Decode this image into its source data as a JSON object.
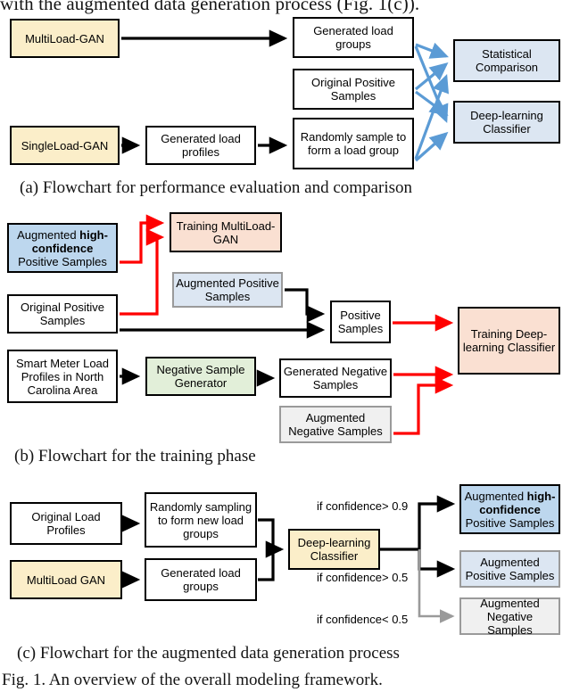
{
  "document": {
    "top_cutoff_line": "with the augmented data generation process (Fig. 1(c)).",
    "figure_caption": "Fig. 1.   An overview of the overall modeling framework."
  },
  "colors": {
    "cream": "#fbeec9",
    "blue_medium": "#bdd7ee",
    "blue_light": "#dce6f2",
    "peach": "#fae0d2",
    "green": "#e2efd9",
    "gray": "#f0f0f0",
    "arrow_black": "#000000",
    "arrow_red": "#ff0000",
    "arrow_blue": "#5b9bd5",
    "arrow_gray": "#9a9a9a"
  },
  "panel_a": {
    "caption": "(a) Flowchart for performance evaluation and comparison",
    "boxes": {
      "multiload_gan": "MultiLoad-GAN",
      "generated_load_groups": "Generated load groups",
      "original_positive_samples": "Original Positive Samples",
      "singleload_gan": "SingleLoad-GAN",
      "generated_load_profiles": "Generated load profiles",
      "randomly_sample": "Randomly sample to form a load group",
      "statistical_comparison": "Statistical Comparison",
      "deep_learning_classifier": "Deep-learning Classifier"
    }
  },
  "panel_b": {
    "caption": "(b) Flowchart for the training phase",
    "boxes": {
      "augmented_high_confidence_pre": "Augmented ",
      "augmented_high_confidence_bold": "high-confidence",
      "augmented_high_confidence_post": " Positive Samples",
      "training_multiload_gan": "Training MultiLoad-GAN",
      "augmented_positive_samples": "Augmented Positive Samples",
      "original_positive_samples": "Original Positive Samples",
      "positive_samples": "Positive Samples",
      "smart_meter_load_profiles": "Smart Meter Load Profiles in North Carolina Area",
      "negative_sample_generator": "Negative Sample Generator",
      "generated_negative_samples": "Generated Negative Samples",
      "augmented_negative_samples": "Augmented Negative Samples",
      "training_deep_learning_classifier": "Training Deep-learning Classifier"
    }
  },
  "panel_c": {
    "caption": "(c) Flowchart for the augmented data generation process",
    "boxes": {
      "original_load_profiles": "Original Load Profiles",
      "randomly_sampling": "Randomly sampling to form new load groups",
      "multiload_gan": "MultiLoad GAN",
      "generated_load_groups": "Generated load groups",
      "deep_learning_classifier": "Deep-learning Classifier",
      "augmented_high_confidence_pre": "Augmented ",
      "augmented_high_confidence_bold": "high-confidence",
      "augmented_high_confidence_post": " Positive Samples",
      "augmented_positive_samples": "Augmented Positive Samples",
      "augmented_negative_samples": "Augmented Negative Samples"
    },
    "conditions": {
      "high": "if confidence> 0.9",
      "mid": "if confidence> 0.5",
      "low": "if confidence< 0.5"
    }
  }
}
